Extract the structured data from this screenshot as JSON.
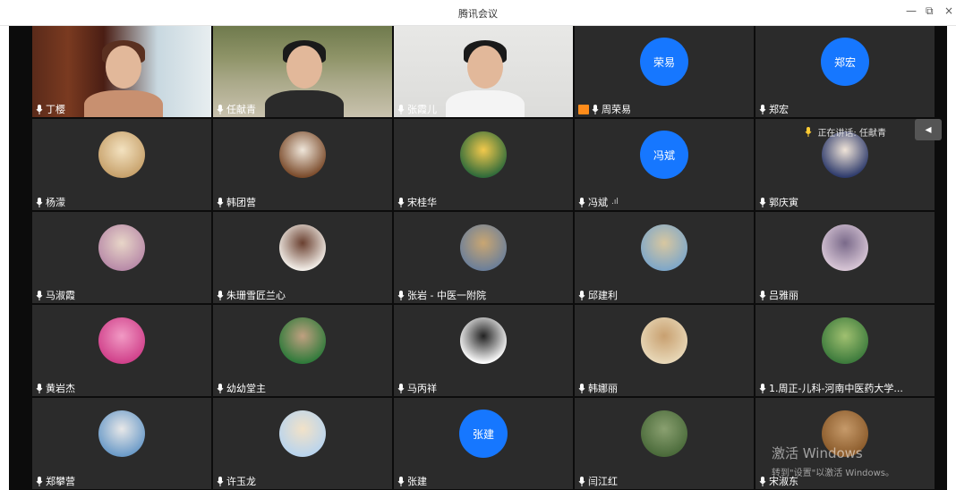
{
  "window": {
    "title": "腾讯会议",
    "controls": [
      "—",
      "⧉",
      "×"
    ]
  },
  "speaking": {
    "label": "正在讲话: 任献青"
  },
  "watermark": {
    "line1": "激活 Windows",
    "line2": "转到\"设置\"以激活 Windows。"
  },
  "participants": [
    {
      "name": "丁樱",
      "kind": "video",
      "bg": "bookshelf"
    },
    {
      "name": "任献青",
      "kind": "video",
      "bg": "lake"
    },
    {
      "name": "张霞儿",
      "kind": "video",
      "bg": "wall"
    },
    {
      "name": "周荣易",
      "kind": "text",
      "avatar_text": "荣易",
      "host": true
    },
    {
      "name": "郑宏",
      "kind": "text",
      "avatar_text": "郑宏"
    },
    {
      "name": "杨濛",
      "kind": "image",
      "colors": [
        "#c7a16b",
        "#f3e2c0"
      ]
    },
    {
      "name": "韩团营",
      "kind": "image",
      "colors": [
        "#7a4a2a",
        "#efe6da"
      ]
    },
    {
      "name": "宋桂华",
      "kind": "image",
      "colors": [
        "#2e6a3a",
        "#f2c94c"
      ]
    },
    {
      "name": "冯斌",
      "kind": "text",
      "avatar_text": "冯斌",
      "signal": ".ıl"
    },
    {
      "name": "郭庆寅",
      "kind": "image",
      "colors": [
        "#2d3a6b",
        "#f0e4d8"
      ]
    },
    {
      "name": "马淑霞",
      "kind": "image",
      "colors": [
        "#b88aa8",
        "#e8d6c8"
      ]
    },
    {
      "name": "朱珊雪匠兰心",
      "kind": "image",
      "colors": [
        "#f4f0ea",
        "#6a4030"
      ]
    },
    {
      "name": "张岩 - 中医一附院",
      "kind": "image",
      "colors": [
        "#6b7f9a",
        "#c9a672"
      ]
    },
    {
      "name": "邱建利",
      "kind": "image",
      "colors": [
        "#7ea7c9",
        "#d8c7a0"
      ]
    },
    {
      "name": "吕雅丽",
      "kind": "image",
      "colors": [
        "#d8c6d6",
        "#7a6a8a"
      ]
    },
    {
      "name": "黄岩杰",
      "kind": "image",
      "colors": [
        "#d0408a",
        "#f19ac4"
      ]
    },
    {
      "name": "幼幼堂主",
      "kind": "image",
      "colors": [
        "#2e7a3a",
        "#c0a080"
      ]
    },
    {
      "name": "马丙祥",
      "kind": "image",
      "colors": [
        "#ffffff",
        "#222222"
      ]
    },
    {
      "name": "韩娜丽",
      "kind": "image",
      "colors": [
        "#e8d8b8",
        "#c8a070"
      ]
    },
    {
      "name": "1.周正-儿科-河南中医药大学...",
      "kind": "image",
      "colors": [
        "#3c7a3c",
        "#a0c070"
      ]
    },
    {
      "name": "郑攀营",
      "kind": "image",
      "colors": [
        "#6a9ac8",
        "#e8e8e8"
      ]
    },
    {
      "name": "许玉龙",
      "kind": "image",
      "colors": [
        "#b8d4ee",
        "#f2e2c8"
      ]
    },
    {
      "name": "张建",
      "kind": "text",
      "avatar_text": "张建"
    },
    {
      "name": "闫江红",
      "kind": "image",
      "colors": [
        "#4a6a3a",
        "#8aa070"
      ]
    },
    {
      "name": "宋淑东",
      "kind": "image",
      "colors": [
        "#8a5a2a",
        "#c69a6a"
      ]
    }
  ]
}
